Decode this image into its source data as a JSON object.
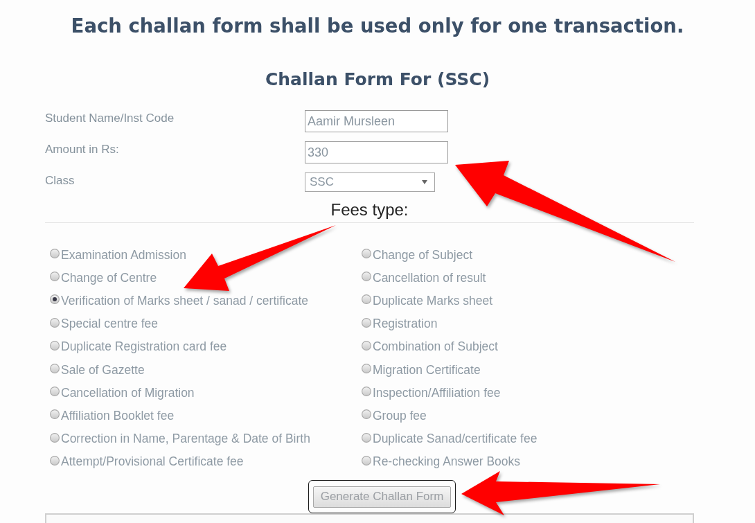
{
  "notice": "Each challan form shall be used only for one transaction.",
  "form": {
    "title": "Challan Form For (SSC)",
    "fields": [
      {
        "label": "Student Name/Inst Code",
        "kind": "text",
        "value": "Aamir Mursleen"
      },
      {
        "label": "Amount in Rs:",
        "kind": "text",
        "value": "330"
      },
      {
        "label": "Class",
        "kind": "select",
        "value": "SSC"
      }
    ],
    "fees_type": {
      "heading": "Fees type:",
      "options": [
        {
          "label": "Examination Admission",
          "selected": false
        },
        {
          "label": "Change of Subject",
          "selected": false
        },
        {
          "label": "Change of Centre",
          "selected": false
        },
        {
          "label": "Cancellation of result",
          "selected": false
        },
        {
          "label": "Verification of Marks sheet / sanad / certificate",
          "selected": true
        },
        {
          "label": "Duplicate Marks sheet",
          "selected": false
        },
        {
          "label": "Special centre fee",
          "selected": false
        },
        {
          "label": "Registration",
          "selected": false
        },
        {
          "label": "Duplicate Registration card fee",
          "selected": false
        },
        {
          "label": "Combination of Subject",
          "selected": false
        },
        {
          "label": "Sale of Gazette",
          "selected": false
        },
        {
          "label": "Migration Certificate",
          "selected": false
        },
        {
          "label": "Cancellation of Migration",
          "selected": false
        },
        {
          "label": "Inspection/Affiliation fee",
          "selected": false
        },
        {
          "label": "Affiliation Booklet fee",
          "selected": false
        },
        {
          "label": "Group fee",
          "selected": false
        },
        {
          "label": "Correction in Name, Parentage & Date of Birth",
          "selected": false
        },
        {
          "label": "Duplicate Sanad/certificate fee",
          "selected": false
        },
        {
          "label": "Attempt/Provisional Certificate fee",
          "selected": false
        },
        {
          "label": "Re-checking Answer Books",
          "selected": false
        }
      ]
    },
    "submit_button": {
      "label": "Generate Challan Form",
      "focused": true
    }
  }
}
